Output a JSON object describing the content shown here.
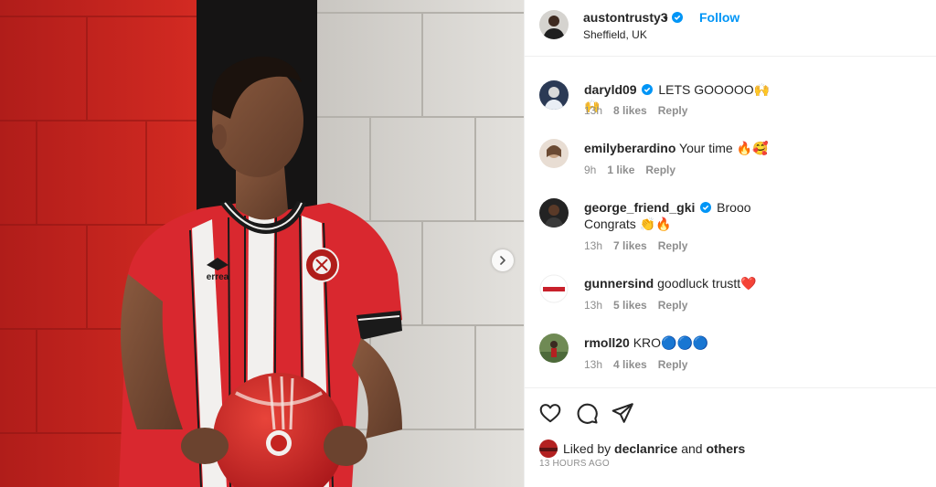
{
  "post": {
    "username": "austontrusty3",
    "separator": "•",
    "follow_label": "Follow",
    "location": "Sheffield, UK"
  },
  "comments": [
    {
      "username": "daryld09",
      "verified": true,
      "text": "LETS GOOOOO🙌🙌",
      "time": "13h",
      "likes": "8 likes",
      "reply": "Reply"
    },
    {
      "username": "emilyberardino",
      "verified": false,
      "text": "Your time 🔥🥰",
      "time": "9h",
      "likes": "1 like",
      "reply": "Reply"
    },
    {
      "username": "george_friend_gki",
      "verified": true,
      "text": "Brooo Congrats 👏🔥",
      "time": "13h",
      "likes": "7 likes",
      "reply": "Reply"
    },
    {
      "username": "gunnersind",
      "verified": false,
      "text": "goodluck trustt❤️",
      "time": "13h",
      "likes": "5 likes",
      "reply": "Reply"
    },
    {
      "username": "rmoll20",
      "verified": false,
      "text": "KRO🔵🔵🔵",
      "time": "13h",
      "likes": "4 likes",
      "reply": "Reply"
    }
  ],
  "likes": {
    "prefix": "Liked by",
    "user": "declanrice",
    "conj": "and",
    "others": "others"
  },
  "time_ago": "13 HOURS AGO",
  "icons": {
    "like": "heart-icon",
    "comment": "comment-icon",
    "share": "send-icon",
    "next": "chevron-right-icon",
    "verified": "verified-badge-icon"
  },
  "colors": {
    "accent": "#0095f6",
    "muted": "#8e8e8e",
    "text": "#262626",
    "shirt_red": "#d9282f"
  },
  "shirt": {
    "brand": "errea"
  }
}
